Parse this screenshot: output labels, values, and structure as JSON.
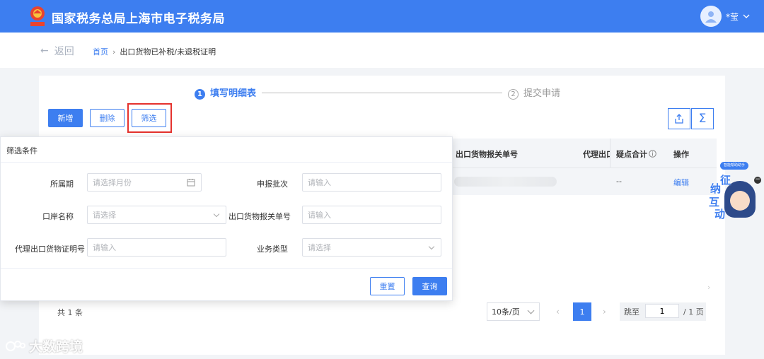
{
  "header": {
    "title": "国家税务总局上海市电子税务局",
    "username": "*莹"
  },
  "nav": {
    "back_label": "返回",
    "breadcrumb_home": "首页",
    "breadcrumb_current": "出口货物已补税/未退税证明"
  },
  "steps": [
    {
      "num": "1",
      "label": "填写明细表"
    },
    {
      "num": "2",
      "label": "提交申请"
    }
  ],
  "toolbar": {
    "add": "新增",
    "delete": "删除",
    "filter": "筛选",
    "export_icon": "export-icon",
    "sum_icon": "sigma-icon"
  },
  "table": {
    "columns": [
      "出口货物报关单号",
      "代理出口",
      "疑点合计",
      "操作"
    ],
    "row": {
      "doubt_total": "--",
      "action": "编辑"
    }
  },
  "filter_panel": {
    "title": "筛选条件",
    "fields": [
      {
        "label": "所属期",
        "placeholder": "请选择月份",
        "type": "month"
      },
      {
        "label": "申报批次",
        "placeholder": "请输入",
        "type": "text"
      },
      {
        "label": "口岸名称",
        "placeholder": "请选择",
        "type": "select"
      },
      {
        "label": "出口货物报关单号",
        "placeholder": "请输入",
        "type": "text"
      },
      {
        "label": "代理出口货物证明号",
        "placeholder": "请输入",
        "type": "text"
      },
      {
        "label": "业务类型",
        "placeholder": "请选择",
        "type": "select"
      }
    ],
    "reset": "重置",
    "query": "查询"
  },
  "pagination": {
    "total": "共 1 条",
    "page_size": "10条/页",
    "current": "1",
    "jump_label": "跳至",
    "jump_value": "1",
    "total_pages": "/ 1 页"
  },
  "widget": {
    "tag": "征纳互动",
    "chars": [
      "征",
      "纳",
      "互",
      "动"
    ],
    "badge": "智能帮助助手"
  },
  "watermark": {
    "text": "大数跨境"
  },
  "colors": {
    "primary": "#3d7ef0",
    "highlight": "#e5322d"
  }
}
